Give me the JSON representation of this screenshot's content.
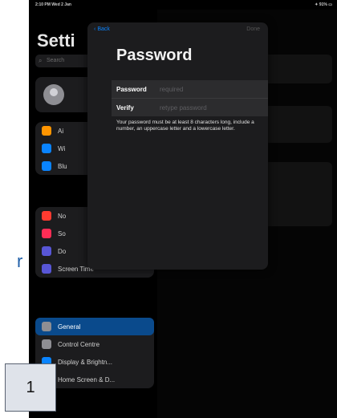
{
  "status_bar": {
    "time": "2:10 PM  Wed 2 Jan",
    "right": "✦ 91% ▭"
  },
  "sidebar": {
    "title": "Setti",
    "search_placeholder": "Search",
    "group1": [
      {
        "label": "Ai",
        "icon": "airplane-icon",
        "color": "#ff9500"
      },
      {
        "label": "Wi",
        "icon": "wifi-icon",
        "color": "#0a84ff"
      },
      {
        "label": "Blu",
        "icon": "bluetooth-icon",
        "color": "#0a84ff"
      }
    ],
    "group2": [
      {
        "label": "No",
        "icon": "notifications-icon",
        "color": "#ff3b30"
      },
      {
        "label": "So",
        "icon": "sounds-icon",
        "color": "#ff2d55"
      },
      {
        "label": "Do",
        "icon": "do-not-disturb-icon",
        "color": "#5856d6"
      },
      {
        "label": "Screen Time",
        "icon": "screen-time-icon",
        "color": "#5856d6"
      }
    ],
    "group3": [
      {
        "label": "General",
        "icon": "gear-icon",
        "color": "#8e8e93",
        "selected": true
      },
      {
        "label": "Control Centre",
        "icon": "control-centre-icon",
        "color": "#8e8e93"
      },
      {
        "label": "Display & Brightn...",
        "icon": "display-icon",
        "color": "#0a84ff"
      },
      {
        "label": "Home Screen & D...",
        "icon": "home-screen-icon",
        "color": "#5856d6"
      }
    ]
  },
  "sheet": {
    "back_label": "Back",
    "done_label": "Done",
    "title": "Password",
    "password_label": "Password",
    "password_placeholder": "required",
    "verify_label": "Verify",
    "verify_placeholder": "retype password",
    "hint": "Your password must be at least 8 characters long, include a number, an uppercase letter and a lowercase letter."
  },
  "outside_letter": "r",
  "callout_number": "1",
  "colors": {
    "accent": "#0a84ff",
    "selected_row": "#0a4a8c",
    "sheet_bg": "#1c1c1e"
  }
}
